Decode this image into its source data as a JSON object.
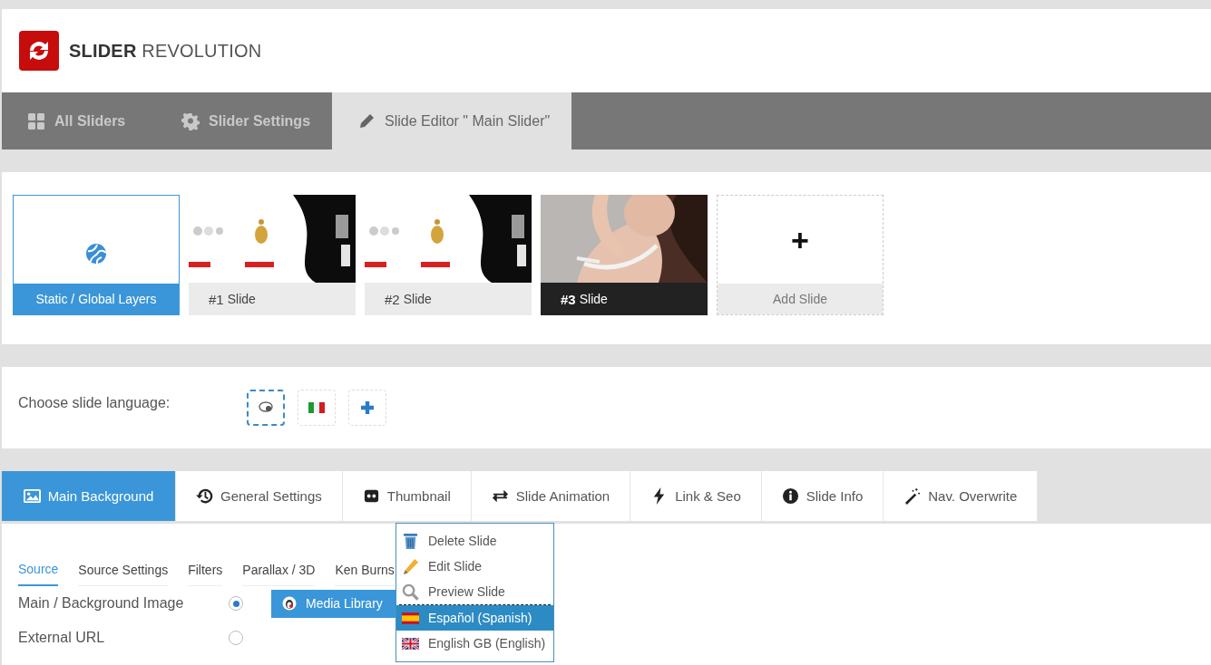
{
  "logo": {
    "bold": "SLIDER",
    "light": "REVOLUTION"
  },
  "nav_tabs": [
    {
      "label": "All Sliders",
      "selected": false
    },
    {
      "label": "Slider Settings",
      "selected": false
    },
    {
      "label": "Slide Editor \" Main Slider\"",
      "selected": true
    }
  ],
  "slides": [
    {
      "kind": "static",
      "label": "Static / Global Layers",
      "selected": true,
      "hovered": false
    },
    {
      "kind": "slide",
      "number": "#1",
      "label": "Slide",
      "selected": false,
      "hovered": false
    },
    {
      "kind": "slide",
      "number": "#2",
      "label": "Slide",
      "selected": false,
      "hovered": false
    },
    {
      "kind": "slide",
      "number": "#3",
      "label": "Slide",
      "selected": false,
      "hovered": true
    },
    {
      "kind": "add",
      "icon": "+",
      "label": "Add Slide",
      "selected": false,
      "hovered": false
    }
  ],
  "language": {
    "label": "Choose slide language:",
    "options": [
      {
        "kind": "default",
        "selected": true
      },
      {
        "kind": "flag",
        "selected": false
      },
      {
        "kind": "add",
        "selected": false
      }
    ]
  },
  "tabs": [
    {
      "label": "Main Background",
      "selected": true
    },
    {
      "label": "General Settings",
      "selected": false
    },
    {
      "label": "Thumbnail",
      "selected": false
    },
    {
      "label": "Slide Animation",
      "selected": false
    },
    {
      "label": "Link & Seo",
      "selected": false
    },
    {
      "label": "Slide Info",
      "selected": false
    },
    {
      "label": "Nav. Overwrite",
      "selected": false
    }
  ],
  "subtabs": [
    {
      "label": "Source",
      "selected": true
    },
    {
      "label": "Source Settings",
      "selected": false
    },
    {
      "label": "Filters",
      "selected": false
    },
    {
      "label": "Parallax / 3D",
      "selected": false
    },
    {
      "label": "Ken Burns",
      "selected": false
    }
  ],
  "source_options": [
    {
      "label": "Main / Background Image",
      "checked": true,
      "button": "Media Library"
    },
    {
      "label": "External URL",
      "checked": false
    }
  ],
  "context_menu": [
    {
      "kind": "action",
      "label": "Delete Slide",
      "highlighted": false
    },
    {
      "kind": "action",
      "label": "Edit Slide",
      "highlighted": false
    },
    {
      "kind": "action",
      "label": "Preview Slide",
      "highlighted": false
    },
    {
      "kind": "language",
      "label": "Español (Spanish)",
      "highlighted": true
    },
    {
      "kind": "language",
      "label": "English GB (English)",
      "highlighted": false
    }
  ]
}
